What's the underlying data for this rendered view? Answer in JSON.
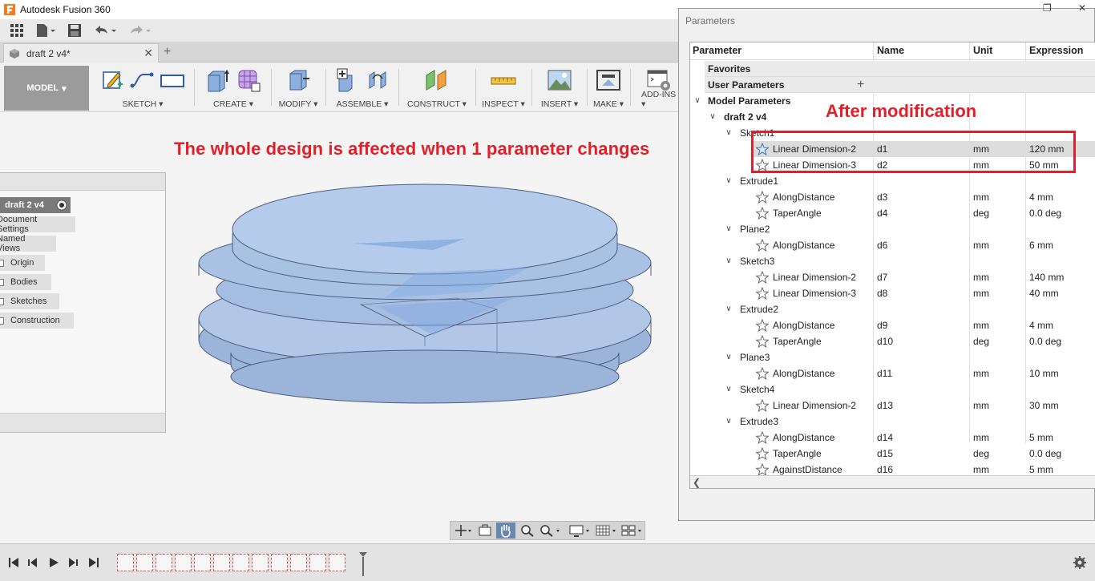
{
  "window": {
    "title": "Autodesk Fusion 360"
  },
  "document_tab": {
    "label": "draft 2 v4*"
  },
  "ribbon": {
    "workspace": "MODEL",
    "groups": [
      {
        "label": "SKETCH"
      },
      {
        "label": "CREATE"
      },
      {
        "label": "MODIFY"
      },
      {
        "label": "ASSEMBLE"
      },
      {
        "label": "CONSTRUCT"
      },
      {
        "label": "INSPECT"
      },
      {
        "label": "INSERT"
      },
      {
        "label": "MAKE"
      },
      {
        "label": "ADD-INS"
      }
    ]
  },
  "annotations": {
    "canvas_note": "The whole design is affected when 1 parameter changes",
    "dialog_note": "After modification"
  },
  "browser": {
    "root": "draft 2 v4",
    "items": [
      "Document Settings",
      "Named Views",
      "Origin",
      "Bodies",
      "Sketches",
      "Construction"
    ]
  },
  "parameters_dialog": {
    "title": "Parameters",
    "columns": [
      "Parameter",
      "Name",
      "Unit",
      "Expression"
    ],
    "favorites": "Favorites",
    "user_parameters": "User Parameters",
    "model_parameters": "Model Parameters",
    "component": "draft 2 v4",
    "features": [
      {
        "name": "Sketch1",
        "params": [
          {
            "label": "Linear Dimension-2",
            "name": "d1",
            "unit": "mm",
            "expr": "120 mm"
          },
          {
            "label": "Linear Dimension-3",
            "name": "d2",
            "unit": "mm",
            "expr": "50 mm"
          }
        ]
      },
      {
        "name": "Extrude1",
        "params": [
          {
            "label": "AlongDistance",
            "name": "d3",
            "unit": "mm",
            "expr": "4 mm"
          },
          {
            "label": "TaperAngle",
            "name": "d4",
            "unit": "deg",
            "expr": "0.0 deg"
          }
        ]
      },
      {
        "name": "Plane2",
        "params": [
          {
            "label": "AlongDistance",
            "name": "d6",
            "unit": "mm",
            "expr": "6 mm"
          }
        ]
      },
      {
        "name": "Sketch3",
        "params": [
          {
            "label": "Linear Dimension-2",
            "name": "d7",
            "unit": "mm",
            "expr": "140 mm"
          },
          {
            "label": "Linear Dimension-3",
            "name": "d8",
            "unit": "mm",
            "expr": "40 mm"
          }
        ]
      },
      {
        "name": "Extrude2",
        "params": [
          {
            "label": "AlongDistance",
            "name": "d9",
            "unit": "mm",
            "expr": "4 mm"
          },
          {
            "label": "TaperAngle",
            "name": "d10",
            "unit": "deg",
            "expr": "0.0 deg"
          }
        ]
      },
      {
        "name": "Plane3",
        "params": [
          {
            "label": "AlongDistance",
            "name": "d11",
            "unit": "mm",
            "expr": "10 mm"
          }
        ]
      },
      {
        "name": "Sketch4",
        "params": [
          {
            "label": "Linear Dimension-2",
            "name": "d13",
            "unit": "mm",
            "expr": "30 mm"
          }
        ]
      },
      {
        "name": "Extrude3",
        "params": [
          {
            "label": "AlongDistance",
            "name": "d14",
            "unit": "mm",
            "expr": "5 mm"
          },
          {
            "label": "TaperAngle",
            "name": "d15",
            "unit": "deg",
            "expr": "0.0 deg"
          },
          {
            "label": "AgainstDistance",
            "name": "d16",
            "unit": "mm",
            "expr": "5 mm"
          }
        ]
      }
    ]
  },
  "colors": {
    "annotation_red": "#e0202a",
    "model_blue": "#a9c1e3",
    "workspace_gray": "#9b9b9b"
  }
}
